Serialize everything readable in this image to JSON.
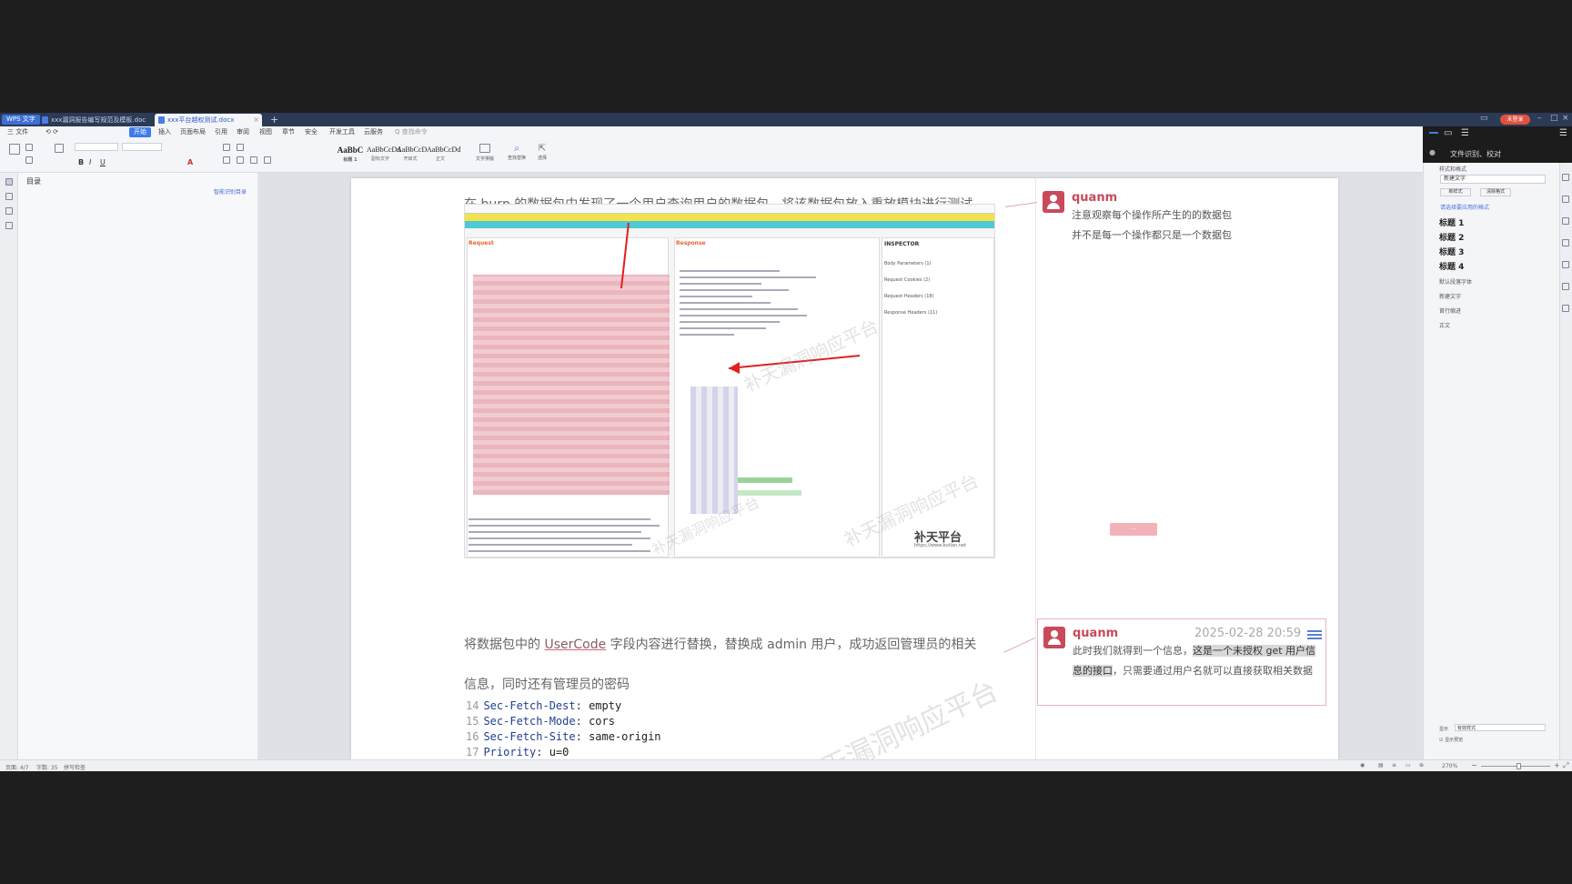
{
  "titlebar": {
    "app_label": "WPS 文字",
    "tabs": [
      {
        "label": "xxx漏洞报告编写规范及模板.docx",
        "active": false
      },
      {
        "label": "xxx平台越权测试.docx",
        "active": true
      }
    ],
    "new_tab": "+",
    "user": "未登录"
  },
  "menu": {
    "items": [
      "三 文件",
      "开始",
      "插入",
      "页面布局",
      "引用",
      "审阅",
      "视图",
      "章节",
      "安全",
      "开发工具",
      "云服务",
      "Q 查找命令"
    ],
    "active_index": 1
  },
  "toolbar": {
    "styles": [
      {
        "preview": "AaBbC",
        "name": "标题 1"
      },
      {
        "preview": "AaBbCcDd",
        "name": "副标文字"
      },
      {
        "preview": "AaBbCcD",
        "name": "开启式"
      },
      {
        "preview": "AaBbCcDd",
        "name": "正文"
      }
    ],
    "style_panel": "文字排版",
    "find_replace": "查找替换",
    "select": "选择"
  },
  "nav": {
    "title": "目录",
    "smart_link": "智能识别目录"
  },
  "document": {
    "para1": "在 burp 的数据包中发现了一个用户查询用户的数据包，将该数据包放入重放模块进行测试",
    "para2_before": "将数据包中的 ",
    "para2_highlight": "UserCode",
    "para2_after": " 字段内容进行替换，替换成 admin 用户，成功返回管理员的相关",
    "para3": "信息，同时还有管理员的密码",
    "code_lines": [
      {
        "num": "14",
        "key": "Sec-Fetch-Dest",
        "value": "empty"
      },
      {
        "num": "15",
        "key": "Sec-Fetch-Mode",
        "value": "cors"
      },
      {
        "num": "16",
        "key": "Sec-Fetch-Site",
        "value": "same-origin"
      },
      {
        "num": "17",
        "key": "Priority",
        "value": "u=0"
      }
    ],
    "screenshot": {
      "request_label": "Request",
      "response_label": "Response",
      "inspector_label": "INSPECTOR",
      "inspector_items": [
        "Body Parameters (1)",
        "Request Cookies (2)",
        "Request Headers (18)",
        "Response Headers (11)"
      ],
      "logo": "补天平台",
      "logo_url": "https://www.butian.net",
      "watermark": "补天漏洞响应平台"
    }
  },
  "comments": [
    {
      "author": "quanm",
      "time": "",
      "text_lines": [
        "注意观察每个操作所产生的的数据包",
        "并不是每一个操作都只是一个数据包"
      ]
    },
    {
      "author": "quanm",
      "time": "2025-02-28 20:59",
      "text_plain": "此时我们就得到一个信息，",
      "text_marked": "这是一个未授权 get 用户信息的接口",
      "text_rest": "，只需要通过用户名就可以直接获取相关数据"
    }
  ],
  "dark_panel": {
    "label": "文件识别、校对"
  },
  "style_pane": {
    "title": "样式和格式",
    "current": "新建文字",
    "buttons": [
      "新样式",
      "清除格式"
    ],
    "list_title": "请选择要应用的格式",
    "headings": [
      "标题 1",
      "标题 2",
      "标题 3",
      "标题 4"
    ],
    "others": [
      "默认段落字体",
      "新建文字",
      "首行缩进",
      "正文"
    ],
    "show_label": "显示",
    "show_value": "有效样式",
    "preview_label": "显示预览"
  },
  "statusbar": {
    "page": "页面: 4/7",
    "words": "字数: 35",
    "spell": "拼写检查",
    "zoom": "270%"
  }
}
